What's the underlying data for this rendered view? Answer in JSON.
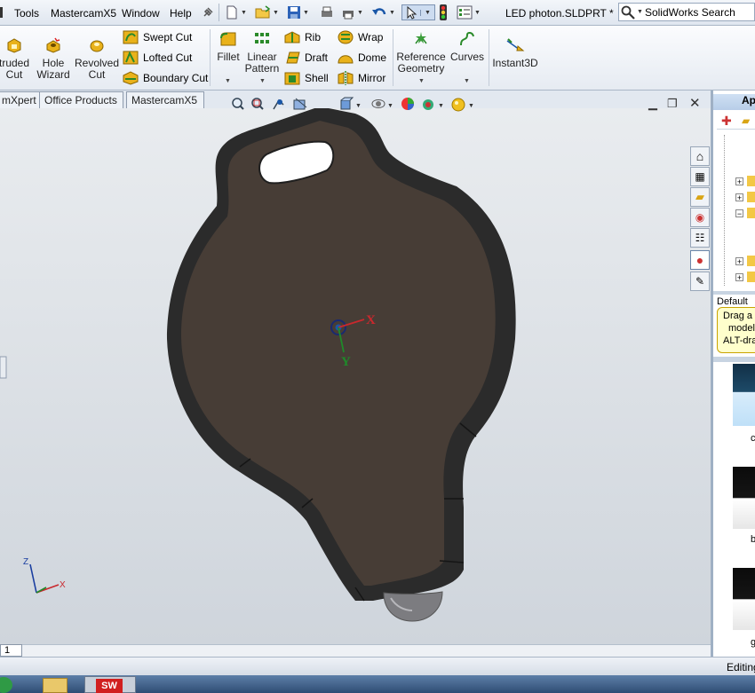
{
  "menu": {
    "tools": "Tools",
    "mastercam": "MastercamX5",
    "window": "Window",
    "help": "Help"
  },
  "document_title": "LED photon.SLDPRT *",
  "search": {
    "label": "SolidWorks Search"
  },
  "ribbon": {
    "extruded_cut": [
      "truded",
      "Cut"
    ],
    "hole_wizard": [
      "Hole",
      "Wizard"
    ],
    "revolved_cut": [
      "Revolved",
      "Cut"
    ],
    "swept_cut": "Swept Cut",
    "lofted_cut": "Lofted Cut",
    "boundary_cut": "Boundary Cut",
    "fillet": "Fillet",
    "linear_pattern": [
      "Linear",
      "Pattern"
    ],
    "rib": "Rib",
    "draft": "Draft",
    "shell": "Shell",
    "wrap": "Wrap",
    "dome": "Dome",
    "mirror": "Mirror",
    "reference_geometry": [
      "Reference",
      "Geometry"
    ],
    "curves": "Curves",
    "instant3d": "Instant3D"
  },
  "tabs": [
    "mXpert",
    "Office Products",
    "MastercamX5"
  ],
  "triad": {
    "x": "X",
    "y": "Y",
    "z": "Z"
  },
  "panel": {
    "header": "Ap",
    "default_label": "Default A",
    "tooltip": [
      "Drag a",
      "model",
      "ALT-dra"
    ],
    "thumb_labels": [
      "c",
      "b",
      "g"
    ]
  },
  "sheet_tab": "1",
  "status": "Editing",
  "colors": {
    "part_face": "#473d36",
    "part_rim": "#2b2b2b",
    "accent_blue": "#1a57a8"
  }
}
